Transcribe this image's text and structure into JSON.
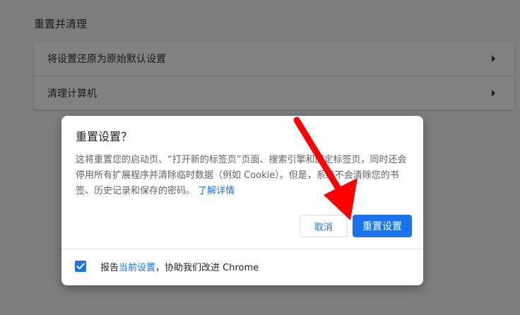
{
  "page": {
    "section_title": "重置并清理",
    "rows": [
      {
        "label": "将设置还原为原始默认设置"
      },
      {
        "label": "清理计算机"
      }
    ]
  },
  "dialog": {
    "title": "重置设置？",
    "body_text": "这将重置您的启动页、“打开新的标签页”页面、搜索引擎和固定标签页，同时还会停用所有扩展程序并清除临时数据（例如 Cookie）。但是，系统不会清除您的书签、历史记录和保存的密码。",
    "learn_more": "了解详情",
    "cancel_label": "取消",
    "reset_label": "重置设置",
    "report": {
      "checked": true,
      "prefix": "报告",
      "link": "当前设置",
      "suffix": "，协助我们改进 Chrome"
    }
  },
  "colors": {
    "accent": "#1a73e8",
    "annotation_arrow": "#ff0000",
    "overlay_bg": "#7e7e7e"
  },
  "icons": {
    "row_arrow": "chevron-right-icon",
    "checkbox_mark": "check-icon",
    "annotation": "red-arrow-annotation"
  }
}
